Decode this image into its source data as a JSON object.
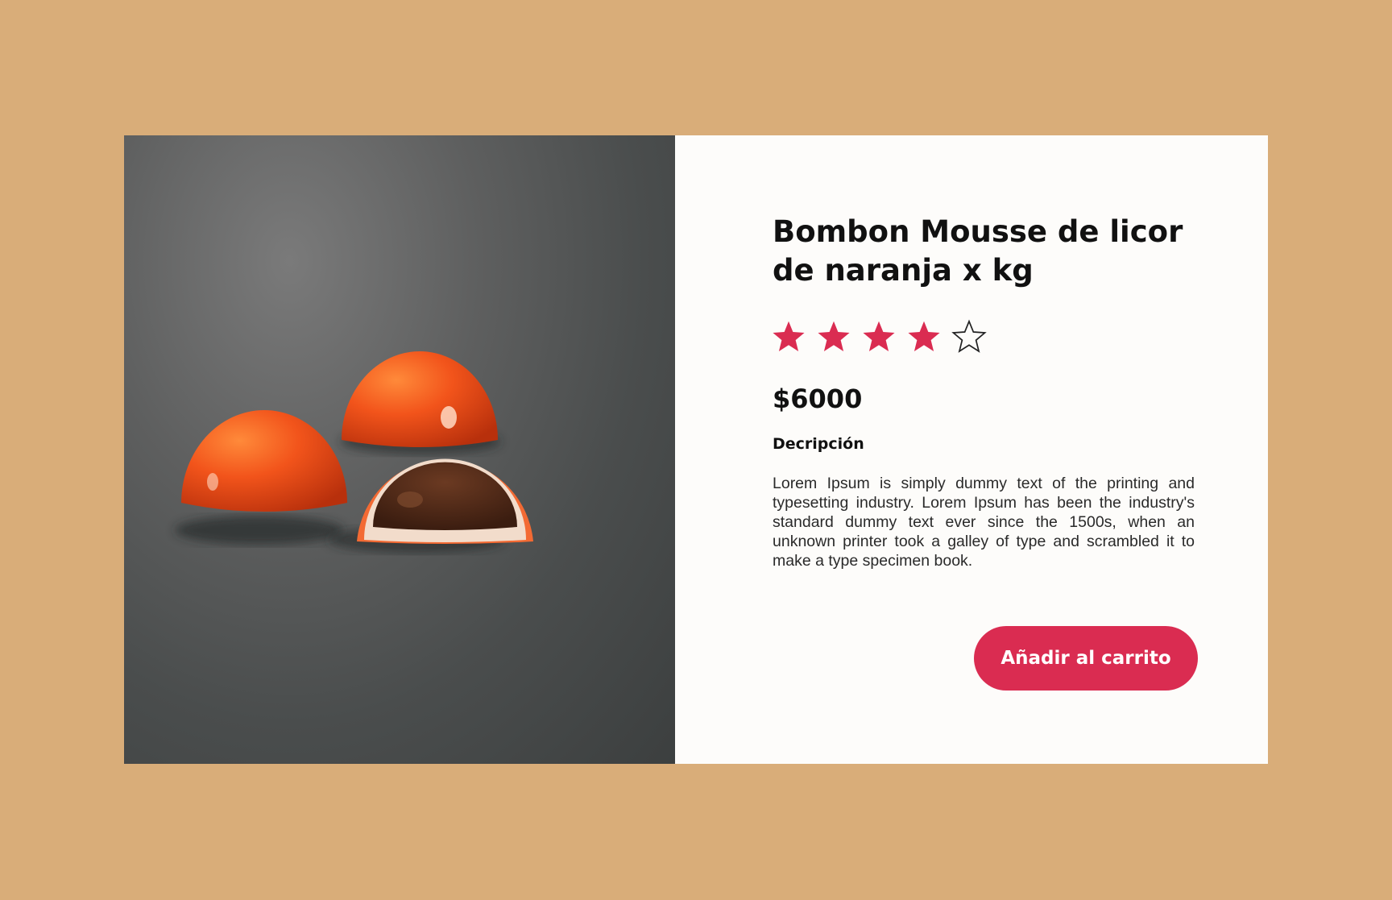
{
  "product": {
    "title": "Bombon Mousse de licor de naranja x kg",
    "rating": 4,
    "rating_max": 5,
    "price": "$6000",
    "description_heading": "Decripción",
    "description": "Lorem Ipsum is simply dummy text of the printing and typesetting industry. Lorem Ipsum has been the industry's standard dummy text ever since the 1500s, when an unknown printer took a galley of type and scrambled it to make a type specimen book.",
    "add_to_cart_label": "Añadir al carrito"
  },
  "colors": {
    "page_background": "#d9ad79",
    "card_background": "#fdfcfa",
    "accent": "#da2c51",
    "star_filled": "#da2c51",
    "star_empty_outline": "#222222"
  },
  "icons": {
    "star_filled": "star-icon",
    "star_empty": "star-outline-icon"
  }
}
